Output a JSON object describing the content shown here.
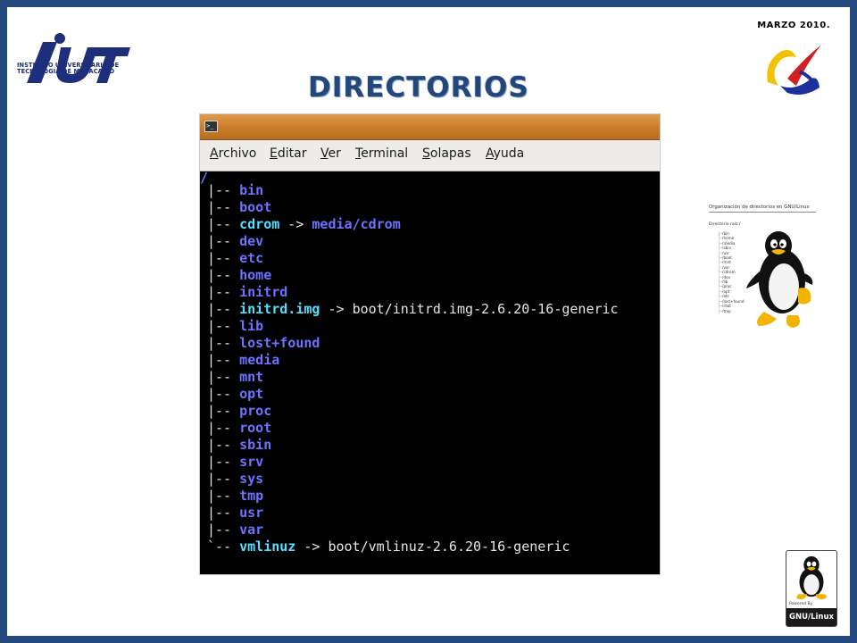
{
  "slide": {
    "date": "MARZO 2010.",
    "title": "DIRECTORIOS",
    "logo": {
      "mark": "IUT",
      "line1": "INSTITUTO UNIVERSITARIO DE",
      "line2": "TECNOLOGÍA DE MARACAIBO"
    }
  },
  "terminal": {
    "menu": [
      "Archivo",
      "Editar",
      "Ver",
      "Terminal",
      "Solapas",
      "Ayuda"
    ],
    "root": "/",
    "entries": [
      {
        "prefix": "|-- ",
        "name": "bin",
        "kind": "dir"
      },
      {
        "prefix": "|-- ",
        "name": "boot",
        "kind": "dir"
      },
      {
        "prefix": "|-- ",
        "name": "cdrom",
        "kind": "link",
        "arrow": " -> ",
        "target": "media/cdrom",
        "target_kind": "dir"
      },
      {
        "prefix": "|-- ",
        "name": "dev",
        "kind": "dir"
      },
      {
        "prefix": "|-- ",
        "name": "etc",
        "kind": "dir"
      },
      {
        "prefix": "|-- ",
        "name": "home",
        "kind": "dir"
      },
      {
        "prefix": "|-- ",
        "name": "initrd",
        "kind": "dir"
      },
      {
        "prefix": "|-- ",
        "name": "initrd.img",
        "kind": "link",
        "arrow": " -> ",
        "target": "boot/initrd.img-2.6.20-16-generic",
        "target_kind": "file"
      },
      {
        "prefix": "|-- ",
        "name": "lib",
        "kind": "dir"
      },
      {
        "prefix": "|-- ",
        "name": "lost+found",
        "kind": "dir"
      },
      {
        "prefix": "|-- ",
        "name": "media",
        "kind": "dir"
      },
      {
        "prefix": "|-- ",
        "name": "mnt",
        "kind": "dir"
      },
      {
        "prefix": "|-- ",
        "name": "opt",
        "kind": "dir"
      },
      {
        "prefix": "|-- ",
        "name": "proc",
        "kind": "dir"
      },
      {
        "prefix": "|-- ",
        "name": "root",
        "kind": "dir"
      },
      {
        "prefix": "|-- ",
        "name": "sbin",
        "kind": "dir"
      },
      {
        "prefix": "|-- ",
        "name": "srv",
        "kind": "dir"
      },
      {
        "prefix": "|-- ",
        "name": "sys",
        "kind": "dir"
      },
      {
        "prefix": "|-- ",
        "name": "tmp",
        "kind": "dir"
      },
      {
        "prefix": "|-- ",
        "name": "usr",
        "kind": "dir"
      },
      {
        "prefix": "|-- ",
        "name": "var",
        "kind": "dir"
      },
      {
        "prefix": "`-- ",
        "name": "vmlinuz",
        "kind": "link",
        "arrow": " -> ",
        "target": "boot/vmlinuz-2.6.20-16-generic",
        "target_kind": "file"
      }
    ]
  },
  "thumbnail": {
    "title": "Organización de directorios en GNU/Linux",
    "subtitle": "Directorio raíz /",
    "items": [
      "/bin",
      "/home",
      "/media",
      "/sbin",
      "/usr",
      "/boot",
      "/mnt",
      "/var",
      "/cdrom",
      "/dev",
      "/lib",
      "/proc",
      "/opt",
      "/etc",
      "/lost+found",
      "/root",
      "/tmp"
    ]
  },
  "badge": {
    "powered": "Powered By",
    "label": "GNU/Linux"
  },
  "colors": {
    "frame": "#24497e",
    "title": "#24477a",
    "dir": "#6d72ff",
    "link": "#53e0ff",
    "titlebar": "#c97c2a"
  }
}
